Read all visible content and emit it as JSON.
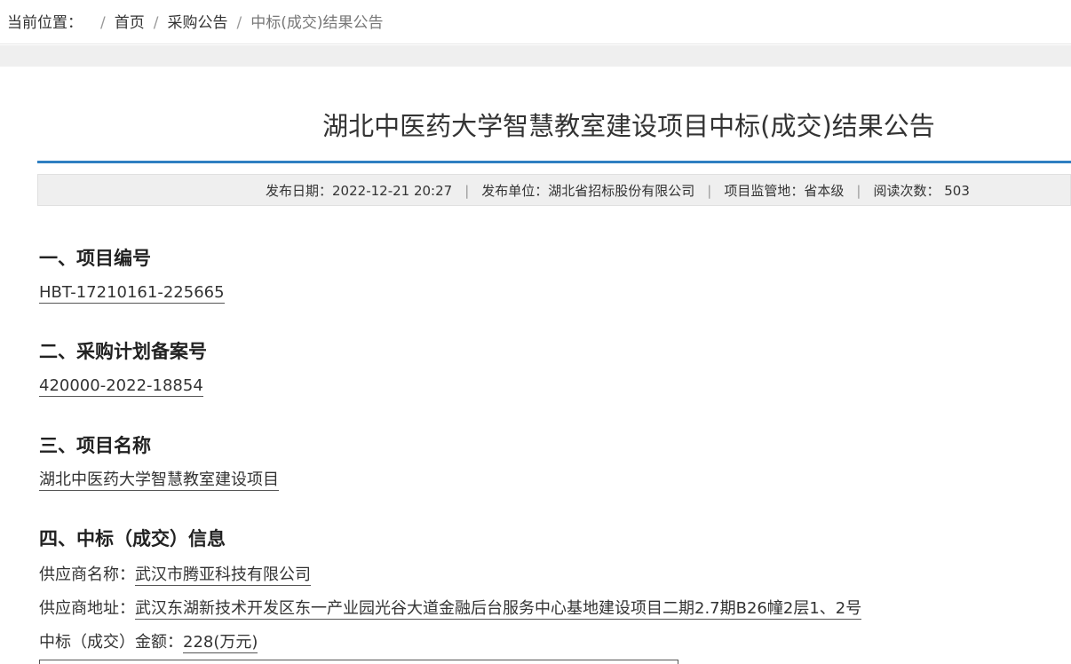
{
  "breadcrumb": {
    "prefix": "当前位置：",
    "items": [
      "首页",
      "采购公告",
      "中标(成交)结果公告"
    ]
  },
  "article": {
    "title": "湖北中医药大学智慧教室建设项目中标(成交)结果公告",
    "meta": {
      "publish_date_label": "发布日期：",
      "publish_date": "2022-12-21 20:27",
      "publisher_label": "发布单位：",
      "publisher": "湖北省招标股份有限公司",
      "region_label": "项目监管地：",
      "region": "省本级",
      "views_label": "阅读次数：",
      "views": "503"
    },
    "sections": [
      {
        "heading": "一、项目编号",
        "value": "HBT-17210161-225665"
      },
      {
        "heading": "二、采购计划备案号",
        "value": "420000-2022-18854"
      },
      {
        "heading": "三、项目名称",
        "value": "湖北中医药大学智慧教室建设项目"
      },
      {
        "heading": "四、中标（成交）信息"
      }
    ],
    "award": {
      "supplier_name_label": "供应商名称：",
      "supplier_name": "武汉市腾亚科技有限公司",
      "supplier_address_label": "供应商地址：",
      "supplier_address": "武汉东湖新技术开发区东一产业园光谷大道金融后台服务中心基地建设项目二期2.7期B26幢2层1、2号",
      "amount_label": "中标（成交）金额：",
      "amount": "228(万元)"
    }
  },
  "colors": {
    "accent_rule": "#2f7fc1",
    "meta_bg": "#efefef"
  }
}
